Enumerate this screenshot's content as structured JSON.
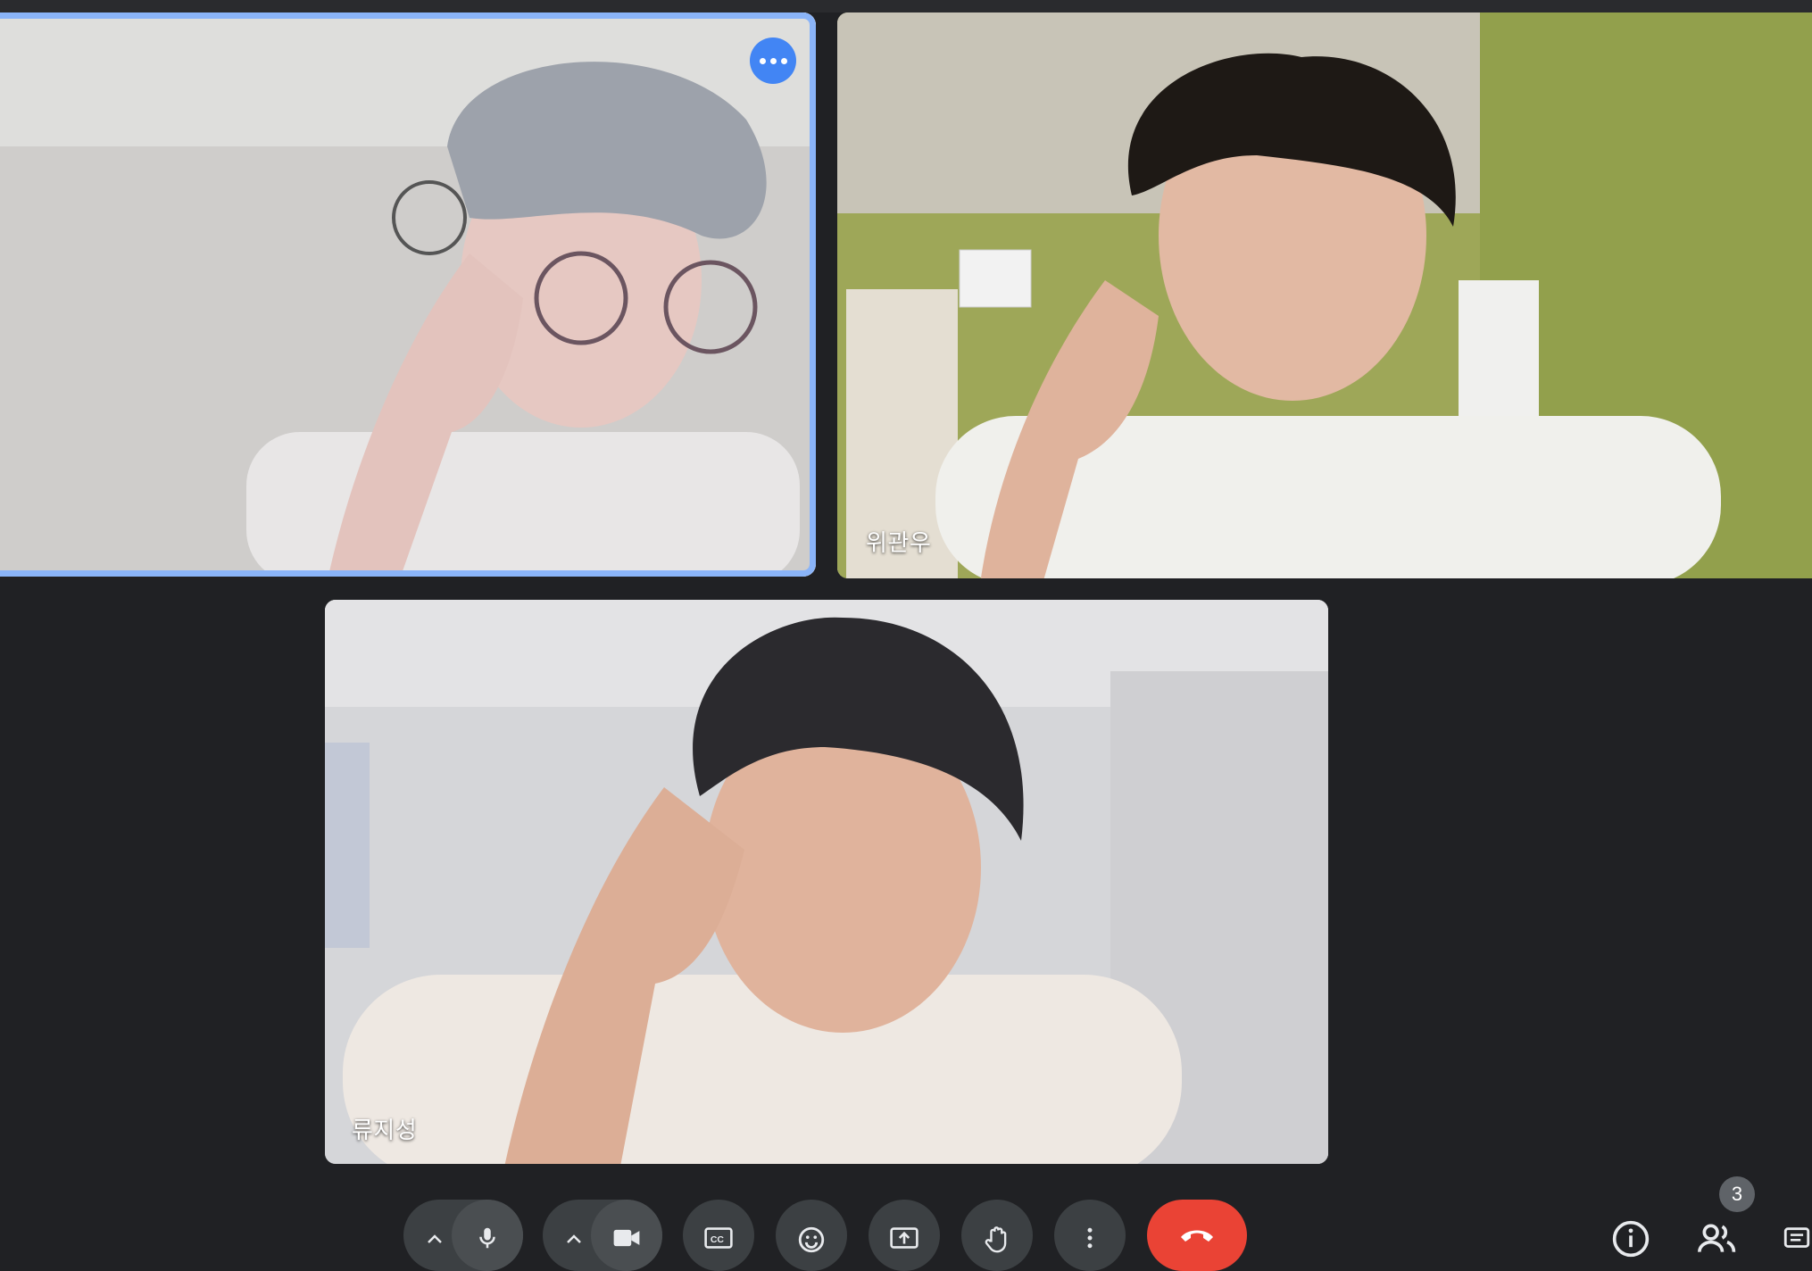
{
  "participants": [
    {
      "id": "self",
      "name": "",
      "active_speaker": true
    },
    {
      "id": "p2",
      "name": "위관우"
    },
    {
      "id": "p3",
      "name": "류지성"
    }
  ],
  "tile_menu_icon": "more-horiz-icon",
  "toolbar": {
    "buttons": [
      {
        "name": "mic-options",
        "icon": "chevron-up-icon"
      },
      {
        "name": "microphone",
        "icon": "mic-icon"
      },
      {
        "name": "camera-options",
        "icon": "chevron-up-icon"
      },
      {
        "name": "camera",
        "icon": "videocam-icon"
      },
      {
        "name": "captions",
        "icon": "closed-caption-icon"
      },
      {
        "name": "reactions",
        "icon": "emoji-icon"
      },
      {
        "name": "present",
        "icon": "present-screen-icon"
      },
      {
        "name": "raise-hand",
        "icon": "hand-icon"
      },
      {
        "name": "more-options",
        "icon": "more-vert-icon"
      },
      {
        "name": "leave-call",
        "icon": "call-end-icon"
      }
    ],
    "right": [
      {
        "name": "meeting-details",
        "icon": "info-icon"
      },
      {
        "name": "people",
        "icon": "people-icon"
      },
      {
        "name": "chat",
        "icon": "chat-icon"
      }
    ],
    "participant_count": "3"
  },
  "colors": {
    "background": "#202124",
    "active_border": "#8ab4f8",
    "accent": "#4285f4",
    "end_call": "#ea4335",
    "control": "#3c4043"
  }
}
